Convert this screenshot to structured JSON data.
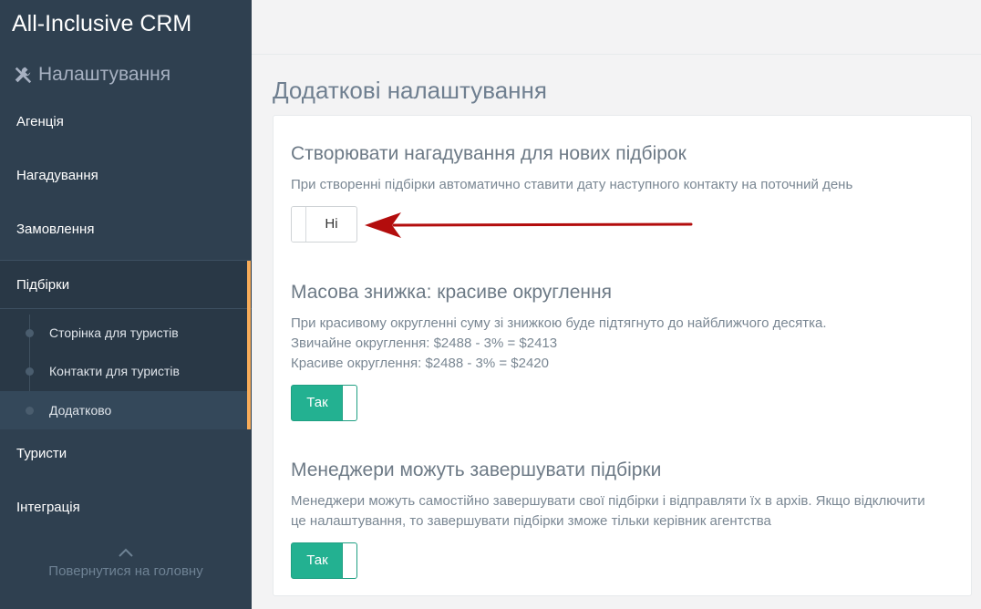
{
  "app": {
    "brand": "All-Inclusive CRM"
  },
  "sidebar": {
    "section_title": "Налаштування",
    "section_icon": "wrench-screwdriver-icon",
    "items": [
      {
        "label": "Агенція"
      },
      {
        "label": "Нагадування"
      },
      {
        "label": "Замовлення"
      },
      {
        "label": "Підбірки"
      },
      {
        "label": "Туристи"
      },
      {
        "label": "Інтеграція"
      }
    ],
    "sub_items": [
      {
        "label": "Сторінка для туристів"
      },
      {
        "label": "Контакти для туристів"
      },
      {
        "label": "Додатково"
      }
    ],
    "back_label": "Повернутися на головну"
  },
  "main": {
    "page_title": "Додаткові налаштування",
    "settings": [
      {
        "title": "Створювати нагадування для нових підбірок",
        "desc": "При створенні підбірки автоматично ставити дату наступного контакту на поточний день",
        "toggle": "Ні"
      },
      {
        "title": "Масова знижка: красиве округлення",
        "desc_lines": [
          "При красивому округленні суму зі знижкою буде підтягнуто до найближчого десятка.",
          "Звичайне округлення: $2488 - 3% = $2413",
          "Красиве округлення: $2488 - 3% = $2420"
        ],
        "toggle": "Так"
      },
      {
        "title": "Менеджери можуть завершувати підбірки",
        "desc_lines": [
          "Менеджери можуть самостійно завершувати свої підбірки і відправляти їх в архів. Якщо відключити",
          "це налаштування, то завершувати підбірки зможе тільки керівник агентства"
        ],
        "toggle": "Так"
      }
    ]
  },
  "colors": {
    "sidebar_bg": "#2f4050",
    "active_accent": "#f8ac59",
    "toggle_on": "#23b191",
    "annotation_arrow": "#b30d0d"
  }
}
